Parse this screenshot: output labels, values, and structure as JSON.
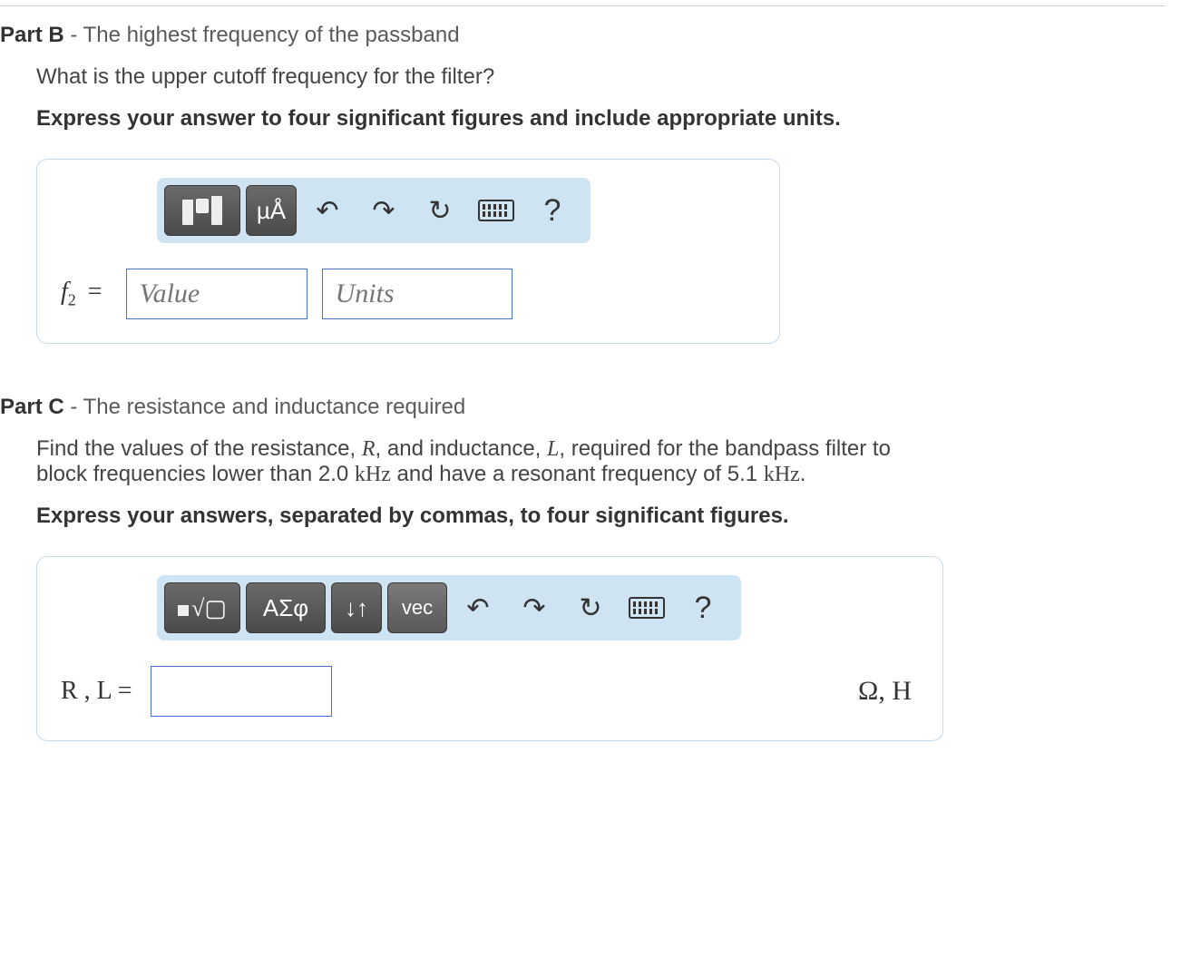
{
  "partB": {
    "label": "Part B",
    "dash": " - ",
    "title": "The highest frequency of the passband",
    "prompt": "What is the upper cutoff frequency for the filter?",
    "instruction": "Express your answer to four significant figures and include appropriate units.",
    "toolbar": {
      "templates": "templates",
      "units_btn": "µÅ",
      "undo": "↶",
      "redo": "↷",
      "reset": "↻",
      "keyboard": "keyboard",
      "help": "?"
    },
    "var_html": "f",
    "var_sub": "2",
    "equals": " = ",
    "value_ph": "Value",
    "units_ph": "Units"
  },
  "partC": {
    "label": "Part C",
    "dash": " - ",
    "title": "The resistance and inductance required",
    "prompt_pre": "Find the values of the resistance, ",
    "R": "R",
    "prompt_mid1": ", and inductance, ",
    "L": "L",
    "prompt_mid2": ", required for the bandpass filter to block frequencies lower than 2.0 ",
    "kHz1": "kHz",
    "prompt_mid3": " and have a resonant frequency of 5.1 ",
    "kHz2": "kHz",
    "prompt_end": ".",
    "instruction": "Express your answers, separated by commas, to four significant figures.",
    "toolbar": {
      "templates": "templates",
      "greek": "ΑΣφ",
      "super_sub": "↓↑",
      "vec": "vec",
      "undo": "↶",
      "redo": "↷",
      "reset": "↻",
      "keyboard": "keyboard",
      "help": "?"
    },
    "var_label": "R , L =",
    "value_ph": "",
    "units_trail": "Ω, H"
  }
}
